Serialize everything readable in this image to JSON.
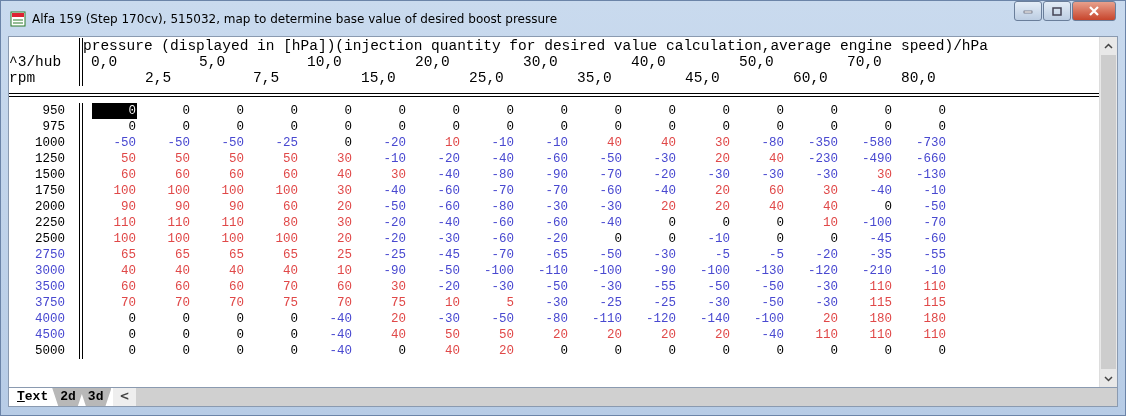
{
  "window": {
    "title": "Alfa 159 (Step 170cv), 515032, map to determine base value of desired boost pressure"
  },
  "map": {
    "x_title": "pressure (displayed in [hPa])(injection quantity for desired value calculation,average engine speed)/hPa",
    "y_unit": "^3/hub",
    "y_title": "rpm",
    "x_axis": [
      "0,0",
      "2,5",
      "5,0",
      "7,5",
      "10,0",
      "15,0",
      "20,0",
      "25,0",
      "30,0",
      "35,0",
      "40,0",
      "45,0",
      "50,0",
      "60,0",
      "70,0",
      "80,0"
    ],
    "rows": [
      {
        "label": "950",
        "color": "#000000",
        "cells": [
          {
            "value": "0",
            "color": "#000000",
            "selected": true
          },
          {
            "value": "0",
            "color": "#000000",
            "selected": false
          },
          {
            "value": "0",
            "color": "#000000",
            "selected": false
          },
          {
            "value": "0",
            "color": "#000000",
            "selected": false
          },
          {
            "value": "0",
            "color": "#000000",
            "selected": false
          },
          {
            "value": "0",
            "color": "#000000",
            "selected": false
          },
          {
            "value": "0",
            "color": "#000000",
            "selected": false
          },
          {
            "value": "0",
            "color": "#000000",
            "selected": false
          },
          {
            "value": "0",
            "color": "#000000",
            "selected": false
          },
          {
            "value": "0",
            "color": "#000000",
            "selected": false
          },
          {
            "value": "0",
            "color": "#000000",
            "selected": false
          },
          {
            "value": "0",
            "color": "#000000",
            "selected": false
          },
          {
            "value": "0",
            "color": "#000000",
            "selected": false
          },
          {
            "value": "0",
            "color": "#000000",
            "selected": false
          },
          {
            "value": "0",
            "color": "#000000",
            "selected": false
          },
          {
            "value": "0",
            "color": "#000000",
            "selected": false
          }
        ]
      },
      {
        "label": "975",
        "color": "#000000",
        "cells": [
          {
            "value": "0",
            "color": "#000000",
            "selected": false
          },
          {
            "value": "0",
            "color": "#000000",
            "selected": false
          },
          {
            "value": "0",
            "color": "#000000",
            "selected": false
          },
          {
            "value": "0",
            "color": "#000000",
            "selected": false
          },
          {
            "value": "0",
            "color": "#000000",
            "selected": false
          },
          {
            "value": "0",
            "color": "#000000",
            "selected": false
          },
          {
            "value": "0",
            "color": "#000000",
            "selected": false
          },
          {
            "value": "0",
            "color": "#000000",
            "selected": false
          },
          {
            "value": "0",
            "color": "#000000",
            "selected": false
          },
          {
            "value": "0",
            "color": "#000000",
            "selected": false
          },
          {
            "value": "0",
            "color": "#000000",
            "selected": false
          },
          {
            "value": "0",
            "color": "#000000",
            "selected": false
          },
          {
            "value": "0",
            "color": "#000000",
            "selected": false
          },
          {
            "value": "0",
            "color": "#000000",
            "selected": false
          },
          {
            "value": "0",
            "color": "#000000",
            "selected": false
          },
          {
            "value": "0",
            "color": "#000000",
            "selected": false
          }
        ]
      },
      {
        "label": "1000",
        "color": "#000000",
        "cells": [
          {
            "value": "-50",
            "color": "#4848d0",
            "selected": false
          },
          {
            "value": "-50",
            "color": "#4848d0",
            "selected": false
          },
          {
            "value": "-50",
            "color": "#4848d0",
            "selected": false
          },
          {
            "value": "-25",
            "color": "#4848d0",
            "selected": false
          },
          {
            "value": "0",
            "color": "#000000",
            "selected": false
          },
          {
            "value": "-20",
            "color": "#4848d0",
            "selected": false
          },
          {
            "value": "10",
            "color": "#e04848",
            "selected": false
          },
          {
            "value": "-10",
            "color": "#4848d0",
            "selected": false
          },
          {
            "value": "-10",
            "color": "#4848d0",
            "selected": false
          },
          {
            "value": "40",
            "color": "#e04848",
            "selected": false
          },
          {
            "value": "40",
            "color": "#e04848",
            "selected": false
          },
          {
            "value": "30",
            "color": "#e04848",
            "selected": false
          },
          {
            "value": "-80",
            "color": "#4848d0",
            "selected": false
          },
          {
            "value": "-350",
            "color": "#4848d0",
            "selected": false
          },
          {
            "value": "-580",
            "color": "#4848d0",
            "selected": false
          },
          {
            "value": "-730",
            "color": "#4848d0",
            "selected": false
          }
        ]
      },
      {
        "label": "1250",
        "color": "#000000",
        "cells": [
          {
            "value": "50",
            "color": "#e04848",
            "selected": false
          },
          {
            "value": "50",
            "color": "#e04848",
            "selected": false
          },
          {
            "value": "50",
            "color": "#e04848",
            "selected": false
          },
          {
            "value": "50",
            "color": "#e04848",
            "selected": false
          },
          {
            "value": "30",
            "color": "#e04848",
            "selected": false
          },
          {
            "value": "-10",
            "color": "#4848d0",
            "selected": false
          },
          {
            "value": "-20",
            "color": "#4848d0",
            "selected": false
          },
          {
            "value": "-40",
            "color": "#4848d0",
            "selected": false
          },
          {
            "value": "-60",
            "color": "#4848d0",
            "selected": false
          },
          {
            "value": "-50",
            "color": "#4848d0",
            "selected": false
          },
          {
            "value": "-30",
            "color": "#4848d0",
            "selected": false
          },
          {
            "value": "20",
            "color": "#e04848",
            "selected": false
          },
          {
            "value": "40",
            "color": "#e04848",
            "selected": false
          },
          {
            "value": "-230",
            "color": "#4848d0",
            "selected": false
          },
          {
            "value": "-490",
            "color": "#4848d0",
            "selected": false
          },
          {
            "value": "-660",
            "color": "#4848d0",
            "selected": false
          }
        ]
      },
      {
        "label": "1500",
        "color": "#000000",
        "cells": [
          {
            "value": "60",
            "color": "#e04848",
            "selected": false
          },
          {
            "value": "60",
            "color": "#e04848",
            "selected": false
          },
          {
            "value": "60",
            "color": "#e04848",
            "selected": false
          },
          {
            "value": "60",
            "color": "#e04848",
            "selected": false
          },
          {
            "value": "40",
            "color": "#e04848",
            "selected": false
          },
          {
            "value": "30",
            "color": "#e04848",
            "selected": false
          },
          {
            "value": "-40",
            "color": "#4848d0",
            "selected": false
          },
          {
            "value": "-80",
            "color": "#4848d0",
            "selected": false
          },
          {
            "value": "-90",
            "color": "#4848d0",
            "selected": false
          },
          {
            "value": "-70",
            "color": "#4848d0",
            "selected": false
          },
          {
            "value": "-20",
            "color": "#4848d0",
            "selected": false
          },
          {
            "value": "-30",
            "color": "#4848d0",
            "selected": false
          },
          {
            "value": "-30",
            "color": "#4848d0",
            "selected": false
          },
          {
            "value": "-30",
            "color": "#4848d0",
            "selected": false
          },
          {
            "value": "30",
            "color": "#e04848",
            "selected": false
          },
          {
            "value": "-130",
            "color": "#4848d0",
            "selected": false
          }
        ]
      },
      {
        "label": "1750",
        "color": "#000000",
        "cells": [
          {
            "value": "100",
            "color": "#e04848",
            "selected": false
          },
          {
            "value": "100",
            "color": "#e04848",
            "selected": false
          },
          {
            "value": "100",
            "color": "#e04848",
            "selected": false
          },
          {
            "value": "100",
            "color": "#e04848",
            "selected": false
          },
          {
            "value": "30",
            "color": "#e04848",
            "selected": false
          },
          {
            "value": "-40",
            "color": "#4848d0",
            "selected": false
          },
          {
            "value": "-60",
            "color": "#4848d0",
            "selected": false
          },
          {
            "value": "-70",
            "color": "#4848d0",
            "selected": false
          },
          {
            "value": "-70",
            "color": "#4848d0",
            "selected": false
          },
          {
            "value": "-60",
            "color": "#4848d0",
            "selected": false
          },
          {
            "value": "-40",
            "color": "#4848d0",
            "selected": false
          },
          {
            "value": "20",
            "color": "#e04848",
            "selected": false
          },
          {
            "value": "60",
            "color": "#e04848",
            "selected": false
          },
          {
            "value": "30",
            "color": "#e04848",
            "selected": false
          },
          {
            "value": "-40",
            "color": "#4848d0",
            "selected": false
          },
          {
            "value": "-10",
            "color": "#4848d0",
            "selected": false
          }
        ]
      },
      {
        "label": "2000",
        "color": "#000000",
        "cells": [
          {
            "value": "90",
            "color": "#e04848",
            "selected": false
          },
          {
            "value": "90",
            "color": "#e04848",
            "selected": false
          },
          {
            "value": "90",
            "color": "#e04848",
            "selected": false
          },
          {
            "value": "60",
            "color": "#e04848",
            "selected": false
          },
          {
            "value": "20",
            "color": "#e04848",
            "selected": false
          },
          {
            "value": "-50",
            "color": "#4848d0",
            "selected": false
          },
          {
            "value": "-60",
            "color": "#4848d0",
            "selected": false
          },
          {
            "value": "-80",
            "color": "#4848d0",
            "selected": false
          },
          {
            "value": "-30",
            "color": "#4848d0",
            "selected": false
          },
          {
            "value": "-30",
            "color": "#4848d0",
            "selected": false
          },
          {
            "value": "20",
            "color": "#e04848",
            "selected": false
          },
          {
            "value": "20",
            "color": "#e04848",
            "selected": false
          },
          {
            "value": "40",
            "color": "#e04848",
            "selected": false
          },
          {
            "value": "40",
            "color": "#e04848",
            "selected": false
          },
          {
            "value": "0",
            "color": "#000000",
            "selected": false
          },
          {
            "value": "-50",
            "color": "#4848d0",
            "selected": false
          }
        ]
      },
      {
        "label": "2250",
        "color": "#000000",
        "cells": [
          {
            "value": "110",
            "color": "#e04848",
            "selected": false
          },
          {
            "value": "110",
            "color": "#e04848",
            "selected": false
          },
          {
            "value": "110",
            "color": "#e04848",
            "selected": false
          },
          {
            "value": "80",
            "color": "#e04848",
            "selected": false
          },
          {
            "value": "30",
            "color": "#e04848",
            "selected": false
          },
          {
            "value": "-20",
            "color": "#4848d0",
            "selected": false
          },
          {
            "value": "-40",
            "color": "#4848d0",
            "selected": false
          },
          {
            "value": "-60",
            "color": "#4848d0",
            "selected": false
          },
          {
            "value": "-60",
            "color": "#4848d0",
            "selected": false
          },
          {
            "value": "-40",
            "color": "#4848d0",
            "selected": false
          },
          {
            "value": "0",
            "color": "#000000",
            "selected": false
          },
          {
            "value": "0",
            "color": "#000000",
            "selected": false
          },
          {
            "value": "0",
            "color": "#000000",
            "selected": false
          },
          {
            "value": "10",
            "color": "#e04848",
            "selected": false
          },
          {
            "value": "-100",
            "color": "#4848d0",
            "selected": false
          },
          {
            "value": "-70",
            "color": "#4848d0",
            "selected": false
          }
        ]
      },
      {
        "label": "2500",
        "color": "#000000",
        "cells": [
          {
            "value": "100",
            "color": "#e04848",
            "selected": false
          },
          {
            "value": "100",
            "color": "#e04848",
            "selected": false
          },
          {
            "value": "100",
            "color": "#e04848",
            "selected": false
          },
          {
            "value": "100",
            "color": "#e04848",
            "selected": false
          },
          {
            "value": "20",
            "color": "#e04848",
            "selected": false
          },
          {
            "value": "-20",
            "color": "#4848d0",
            "selected": false
          },
          {
            "value": "-30",
            "color": "#4848d0",
            "selected": false
          },
          {
            "value": "-60",
            "color": "#4848d0",
            "selected": false
          },
          {
            "value": "-20",
            "color": "#4848d0",
            "selected": false
          },
          {
            "value": "0",
            "color": "#000000",
            "selected": false
          },
          {
            "value": "0",
            "color": "#000000",
            "selected": false
          },
          {
            "value": "-10",
            "color": "#4848d0",
            "selected": false
          },
          {
            "value": "0",
            "color": "#000000",
            "selected": false
          },
          {
            "value": "0",
            "color": "#000000",
            "selected": false
          },
          {
            "value": "-45",
            "color": "#4848d0",
            "selected": false
          },
          {
            "value": "-60",
            "color": "#4848d0",
            "selected": false
          }
        ]
      },
      {
        "label": "2750",
        "color": "#4848d0",
        "cells": [
          {
            "value": "65",
            "color": "#e04848",
            "selected": false
          },
          {
            "value": "65",
            "color": "#e04848",
            "selected": false
          },
          {
            "value": "65",
            "color": "#e04848",
            "selected": false
          },
          {
            "value": "65",
            "color": "#e04848",
            "selected": false
          },
          {
            "value": "25",
            "color": "#e04848",
            "selected": false
          },
          {
            "value": "-25",
            "color": "#4848d0",
            "selected": false
          },
          {
            "value": "-45",
            "color": "#4848d0",
            "selected": false
          },
          {
            "value": "-70",
            "color": "#4848d0",
            "selected": false
          },
          {
            "value": "-65",
            "color": "#4848d0",
            "selected": false
          },
          {
            "value": "-50",
            "color": "#4848d0",
            "selected": false
          },
          {
            "value": "-30",
            "color": "#4848d0",
            "selected": false
          },
          {
            "value": "-5",
            "color": "#4848d0",
            "selected": false
          },
          {
            "value": "-5",
            "color": "#4848d0",
            "selected": false
          },
          {
            "value": "-20",
            "color": "#4848d0",
            "selected": false
          },
          {
            "value": "-35",
            "color": "#4848d0",
            "selected": false
          },
          {
            "value": "-55",
            "color": "#4848d0",
            "selected": false
          }
        ]
      },
      {
        "label": "3000",
        "color": "#4848d0",
        "cells": [
          {
            "value": "40",
            "color": "#e04848",
            "selected": false
          },
          {
            "value": "40",
            "color": "#e04848",
            "selected": false
          },
          {
            "value": "40",
            "color": "#e04848",
            "selected": false
          },
          {
            "value": "40",
            "color": "#e04848",
            "selected": false
          },
          {
            "value": "10",
            "color": "#e04848",
            "selected": false
          },
          {
            "value": "-90",
            "color": "#4848d0",
            "selected": false
          },
          {
            "value": "-50",
            "color": "#4848d0",
            "selected": false
          },
          {
            "value": "-100",
            "color": "#4848d0",
            "selected": false
          },
          {
            "value": "-110",
            "color": "#4848d0",
            "selected": false
          },
          {
            "value": "-100",
            "color": "#4848d0",
            "selected": false
          },
          {
            "value": "-90",
            "color": "#4848d0",
            "selected": false
          },
          {
            "value": "-100",
            "color": "#4848d0",
            "selected": false
          },
          {
            "value": "-130",
            "color": "#4848d0",
            "selected": false
          },
          {
            "value": "-120",
            "color": "#4848d0",
            "selected": false
          },
          {
            "value": "-210",
            "color": "#4848d0",
            "selected": false
          },
          {
            "value": "-10",
            "color": "#4848d0",
            "selected": false
          }
        ]
      },
      {
        "label": "3500",
        "color": "#4848d0",
        "cells": [
          {
            "value": "60",
            "color": "#e04848",
            "selected": false
          },
          {
            "value": "60",
            "color": "#e04848",
            "selected": false
          },
          {
            "value": "60",
            "color": "#e04848",
            "selected": false
          },
          {
            "value": "70",
            "color": "#e04848",
            "selected": false
          },
          {
            "value": "60",
            "color": "#e04848",
            "selected": false
          },
          {
            "value": "30",
            "color": "#e04848",
            "selected": false
          },
          {
            "value": "-20",
            "color": "#4848d0",
            "selected": false
          },
          {
            "value": "-30",
            "color": "#4848d0",
            "selected": false
          },
          {
            "value": "-50",
            "color": "#4848d0",
            "selected": false
          },
          {
            "value": "-30",
            "color": "#4848d0",
            "selected": false
          },
          {
            "value": "-55",
            "color": "#4848d0",
            "selected": false
          },
          {
            "value": "-50",
            "color": "#4848d0",
            "selected": false
          },
          {
            "value": "-50",
            "color": "#4848d0",
            "selected": false
          },
          {
            "value": "-30",
            "color": "#4848d0",
            "selected": false
          },
          {
            "value": "110",
            "color": "#e04848",
            "selected": false
          },
          {
            "value": "110",
            "color": "#e04848",
            "selected": false
          }
        ]
      },
      {
        "label": "3750",
        "color": "#4848d0",
        "cells": [
          {
            "value": "70",
            "color": "#e04848",
            "selected": false
          },
          {
            "value": "70",
            "color": "#e04848",
            "selected": false
          },
          {
            "value": "70",
            "color": "#e04848",
            "selected": false
          },
          {
            "value": "75",
            "color": "#e04848",
            "selected": false
          },
          {
            "value": "70",
            "color": "#e04848",
            "selected": false
          },
          {
            "value": "75",
            "color": "#e04848",
            "selected": false
          },
          {
            "value": "10",
            "color": "#e04848",
            "selected": false
          },
          {
            "value": "5",
            "color": "#e04848",
            "selected": false
          },
          {
            "value": "-30",
            "color": "#4848d0",
            "selected": false
          },
          {
            "value": "-25",
            "color": "#4848d0",
            "selected": false
          },
          {
            "value": "-25",
            "color": "#4848d0",
            "selected": false
          },
          {
            "value": "-30",
            "color": "#4848d0",
            "selected": false
          },
          {
            "value": "-50",
            "color": "#4848d0",
            "selected": false
          },
          {
            "value": "-30",
            "color": "#4848d0",
            "selected": false
          },
          {
            "value": "115",
            "color": "#e04848",
            "selected": false
          },
          {
            "value": "115",
            "color": "#e04848",
            "selected": false
          }
        ]
      },
      {
        "label": "4000",
        "color": "#4848d0",
        "cells": [
          {
            "value": "0",
            "color": "#000000",
            "selected": false
          },
          {
            "value": "0",
            "color": "#000000",
            "selected": false
          },
          {
            "value": "0",
            "color": "#000000",
            "selected": false
          },
          {
            "value": "0",
            "color": "#000000",
            "selected": false
          },
          {
            "value": "-40",
            "color": "#4848d0",
            "selected": false
          },
          {
            "value": "20",
            "color": "#e04848",
            "selected": false
          },
          {
            "value": "-30",
            "color": "#4848d0",
            "selected": false
          },
          {
            "value": "-50",
            "color": "#4848d0",
            "selected": false
          },
          {
            "value": "-80",
            "color": "#4848d0",
            "selected": false
          },
          {
            "value": "-110",
            "color": "#4848d0",
            "selected": false
          },
          {
            "value": "-120",
            "color": "#4848d0",
            "selected": false
          },
          {
            "value": "-140",
            "color": "#4848d0",
            "selected": false
          },
          {
            "value": "-100",
            "color": "#4848d0",
            "selected": false
          },
          {
            "value": "20",
            "color": "#e04848",
            "selected": false
          },
          {
            "value": "180",
            "color": "#e04848",
            "selected": false
          },
          {
            "value": "180",
            "color": "#e04848",
            "selected": false
          }
        ]
      },
      {
        "label": "4500",
        "color": "#4848d0",
        "cells": [
          {
            "value": "0",
            "color": "#000000",
            "selected": false
          },
          {
            "value": "0",
            "color": "#000000",
            "selected": false
          },
          {
            "value": "0",
            "color": "#000000",
            "selected": false
          },
          {
            "value": "0",
            "color": "#000000",
            "selected": false
          },
          {
            "value": "-40",
            "color": "#4848d0",
            "selected": false
          },
          {
            "value": "40",
            "color": "#e04848",
            "selected": false
          },
          {
            "value": "50",
            "color": "#e04848",
            "selected": false
          },
          {
            "value": "50",
            "color": "#e04848",
            "selected": false
          },
          {
            "value": "20",
            "color": "#e04848",
            "selected": false
          },
          {
            "value": "20",
            "color": "#e04848",
            "selected": false
          },
          {
            "value": "20",
            "color": "#e04848",
            "selected": false
          },
          {
            "value": "20",
            "color": "#e04848",
            "selected": false
          },
          {
            "value": "-40",
            "color": "#4848d0",
            "selected": false
          },
          {
            "value": "110",
            "color": "#e04848",
            "selected": false
          },
          {
            "value": "110",
            "color": "#e04848",
            "selected": false
          },
          {
            "value": "110",
            "color": "#e04848",
            "selected": false
          }
        ]
      },
      {
        "label": "5000",
        "color": "#000000",
        "cells": [
          {
            "value": "0",
            "color": "#000000",
            "selected": false
          },
          {
            "value": "0",
            "color": "#000000",
            "selected": false
          },
          {
            "value": "0",
            "color": "#000000",
            "selected": false
          },
          {
            "value": "0",
            "color": "#000000",
            "selected": false
          },
          {
            "value": "-40",
            "color": "#4848d0",
            "selected": false
          },
          {
            "value": "0",
            "color": "#000000",
            "selected": false
          },
          {
            "value": "40",
            "color": "#e04848",
            "selected": false
          },
          {
            "value": "20",
            "color": "#e04848",
            "selected": false
          },
          {
            "value": "0",
            "color": "#000000",
            "selected": false
          },
          {
            "value": "0",
            "color": "#000000",
            "selected": false
          },
          {
            "value": "0",
            "color": "#000000",
            "selected": false
          },
          {
            "value": "0",
            "color": "#000000",
            "selected": false
          },
          {
            "value": "0",
            "color": "#000000",
            "selected": false
          },
          {
            "value": "0",
            "color": "#000000",
            "selected": false
          },
          {
            "value": "0",
            "color": "#000000",
            "selected": false
          },
          {
            "value": "0",
            "color": "#000000",
            "selected": false
          }
        ]
      }
    ]
  },
  "tabs": [
    {
      "label": "Text",
      "selected": true
    },
    {
      "label": "2d",
      "selected": false
    },
    {
      "label": "3d",
      "selected": false
    }
  ],
  "scroll_left": "<"
}
